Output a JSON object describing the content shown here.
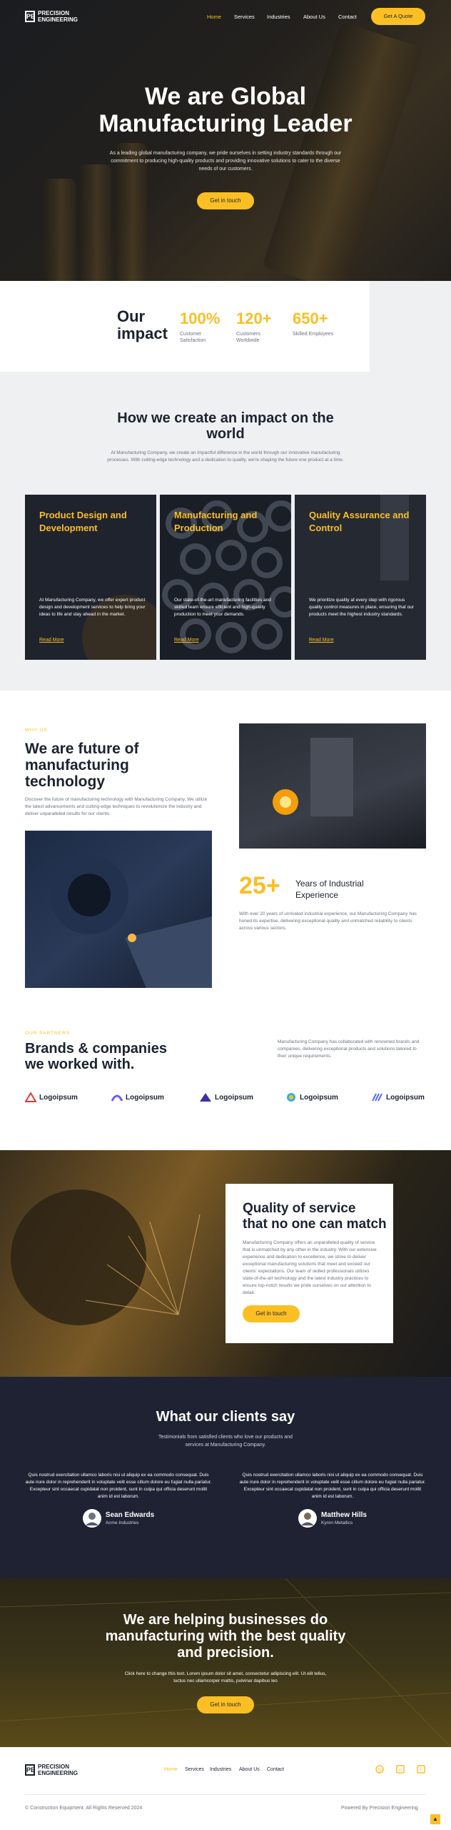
{
  "brand": {
    "line1": "PRECISION",
    "line2": "ENGINEERING",
    "mark": "PE"
  },
  "nav": {
    "items": [
      "Home",
      "Services",
      "Industries",
      "About Us",
      "Contact"
    ],
    "cta": "Get A Quote"
  },
  "hero": {
    "title_line1": "We are Global",
    "title_line2": "Manufacturing Leader",
    "subtitle": "As a leading global manufacturing company, we pride ourselves in setting industry standards through our commitment to producing high-quality products and providing innovative solutions to cater to the diverse needs of our customers.",
    "button": "Get in touch"
  },
  "impact": {
    "title_line1": "Our",
    "title_line2": "impact",
    "stats": [
      {
        "value": "100%",
        "label1": "Customer",
        "label2": "Satisfaction"
      },
      {
        "value": "120+",
        "label1": "Customers",
        "label2": "Worldwide"
      },
      {
        "value": "650+",
        "label1": "Skilled Employees",
        "label2": ""
      }
    ]
  },
  "how": {
    "title_line1": "How we create an impact on the",
    "title_line2": "world",
    "subtitle": "At Manufacturing Company, we create an impactful difference in the world through our innovative manufacturing processes. With cutting-edge technology and a dedication to quality, we're shaping the future one product at a time.",
    "cards": [
      {
        "title": "Product Design and Development",
        "text": "At Manufacturing Company, we offer expert product design and development services to help bring your ideas to life and stay ahead in the market.",
        "link": "Read More"
      },
      {
        "title": "Manufacturing and Production",
        "text": "Our state-of-the-art manufacturing facilities and skilled team ensure efficient and high-quality production to meet your demands.",
        "link": "Read More"
      },
      {
        "title": "Quality Assurance and Control",
        "text": "We prioritize quality at every step with rigorous quality control measures in place, ensuring that our products meet the highest industry standards.",
        "link": "Read More"
      }
    ]
  },
  "why": {
    "eyebrow": "WHY US",
    "title_line1": "We are future of",
    "title_line2": "manufacturing",
    "title_line3": "technology",
    "text": "Discover the future of manufacturing technology with Manufacturing Company. We utilize the latest advancements and cutting-edge techniques to revolutionize the industry and deliver unparalleled results for our clients.",
    "years_value": "25+",
    "years_label1": "Years of Industrial",
    "years_label2": "Experience",
    "years_text": "With over 20 years of unrivaled industrial experience, our Manufacturing Company has honed its expertise, delivering exceptional quality and unmatched reliability to clients across various sectors."
  },
  "partners": {
    "eyebrow": "OUR PARTNERS",
    "title_line1": "Brands & companies",
    "title_line2": "we worked with.",
    "text": "Manufacturing Company has collaborated with renowned brands and companies, delivering exceptional products and solutions tailored to their unique requirements.",
    "logos": [
      {
        "name": "Logoipsum",
        "color": "#e53935"
      },
      {
        "name": "Logoipsum",
        "color": "#6b5cff"
      },
      {
        "name": "Logoipsum",
        "color": "#3b2fa8"
      },
      {
        "name": "Logoipsum",
        "color": "#2bb3e6"
      },
      {
        "name": "Logoipsum",
        "color": "#5c6bff"
      }
    ]
  },
  "quality": {
    "title_line1": "Quality of service",
    "title_line2": "that no one can match",
    "text": "Manufacturing Company offers an unparalleled quality of service that is unmatched by any other in the industry. With our extensive experience and dedication to excellence, we strive to deliver exceptional manufacturing solutions that meet and exceed our clients' expectations. Our team of skilled professionals utilizes state-of-the-art technology and the latest industry practices to ensure top-notch results we pride ourselves on our attention to detail.",
    "button": "Get in touch"
  },
  "testimonials": {
    "title": "What our clients say",
    "subtitle_line1": "Testimonials from satisfied clients who love our products and",
    "subtitle_line2": "services at Manufacturing Company.",
    "items": [
      {
        "quote": "Quis nostrud exercitation ullamco laboris nisi ut aliquip ex ea commodo consequat. Duis aute irure dolor in reprehenderit in voluptate velit esse cillum dolore eu fugiat nulla pariatur. Excepteur sint occaecat cupidatat non proident, sunt in culpa qui officia deserunt mollit anim id est laborum.",
        "name": "Sean Edwards",
        "company": "Acme Industries"
      },
      {
        "quote": "Quis nostrud exercitation ullamco laboris nisi ut aliquip ex ea commodo consequat. Duis aute irure dolor in reprehenderit in voluptate velit esse cillum dolore eu fugiat nulla pariatur. Excepteur sint occaecat cupidatat non proident, sunt in culpa qui officia deserunt mollit anim id est laborum.",
        "name": "Matthew Hills",
        "company": "Kyron Metallics"
      }
    ]
  },
  "cta": {
    "title_line1": "We are helping businesses do",
    "title_line2": "manufacturing with the best quality",
    "title_line3": "and precision.",
    "text_line1": "Click here to change this text. Lorem ipsum dolor sit amet, consectetur adipiscing elit. Ut elit tellus,",
    "text_line2": "luctus nec ullamcorper mattis, pulvinar dapibus leo",
    "button": "Get in touch"
  },
  "footer": {
    "nav": [
      "Home",
      "Services",
      "Industries",
      "About Us",
      "Contact"
    ],
    "copyright": "© Construction Equipment. All Rights Reserved 2024",
    "powered": "Powered By Precision Engineering",
    "social": [
      "skype-icon",
      "linkedin-icon",
      "facebook-icon"
    ]
  },
  "colors": {
    "accent": "#fbbf24",
    "dark": "#1f2233",
    "navy": "#1c2230"
  }
}
